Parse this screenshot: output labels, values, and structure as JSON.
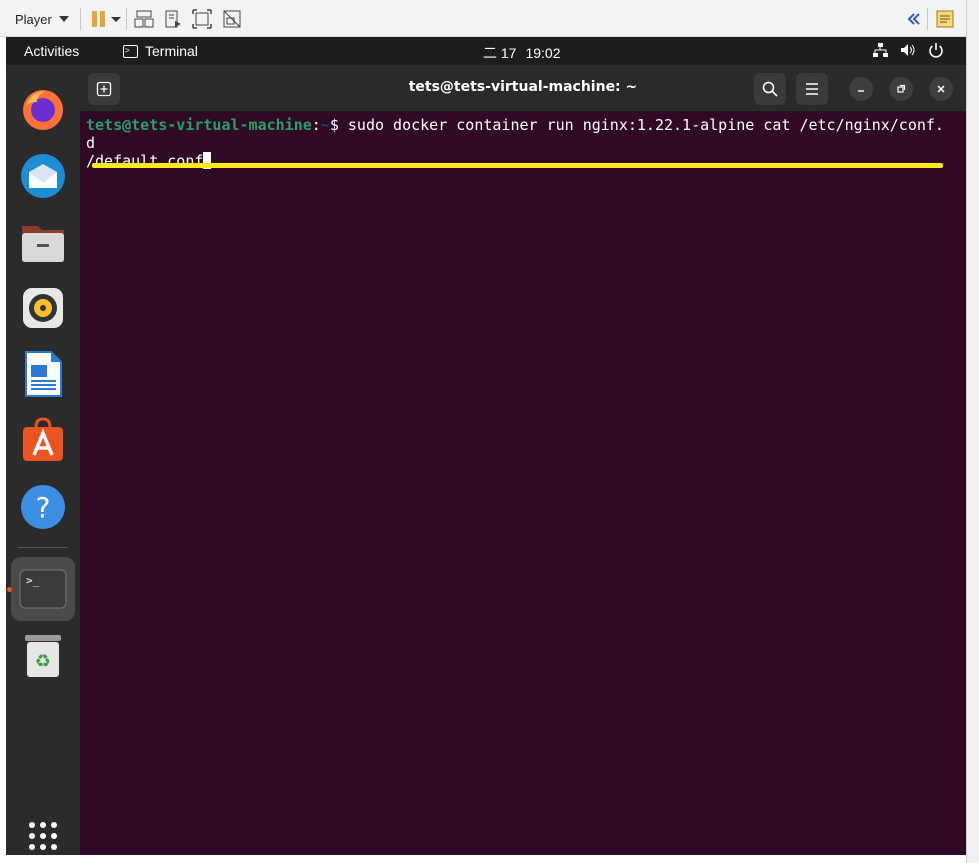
{
  "player_bar": {
    "menu_label": "Player",
    "icons": [
      "pause-icon",
      "send-ctrl-alt-del-icon",
      "removable-devices-icon",
      "fullscreen-icon",
      "unity-icon",
      "collapse-icon",
      "notes-icon"
    ]
  },
  "topbar": {
    "activities": "Activities",
    "app_name": "Terminal",
    "date": "二 17",
    "time": "19:02",
    "status_icons": [
      "network-icon",
      "volume-icon",
      "power-icon"
    ]
  },
  "dock": {
    "apps": [
      "firefox-icon",
      "thunderbird-icon",
      "files-icon",
      "rhythmbox-icon",
      "writer-icon",
      "software-icon",
      "help-icon",
      "terminal-icon",
      "trash-icon"
    ],
    "grid": "show-apps-icon",
    "colors": {
      "firefox": "#ff7139",
      "thunderbird": "#1f8dd6",
      "files": "#7a7a7a",
      "rhythmbox": "#f3c12c",
      "writer": "#2a7bd4",
      "software": "#e95420",
      "help": "#3d8fe4"
    }
  },
  "terminal": {
    "title": "tets@tets-virtual-machine: ~",
    "prompt_user": "tets@tets-virtual-machine",
    "prompt_sep": ":",
    "prompt_path": "~",
    "prompt_symbol": "$ ",
    "command_line1": "sudo docker container run nginx:1.22.1-alpine cat /etc/nginx/conf.d",
    "command_line2": "/default.conf"
  },
  "colors": {
    "terminal_bg": "#300a24",
    "prompt_user": "#26a269",
    "prompt_path": "#12488b",
    "annotation": "#fcea1c"
  }
}
